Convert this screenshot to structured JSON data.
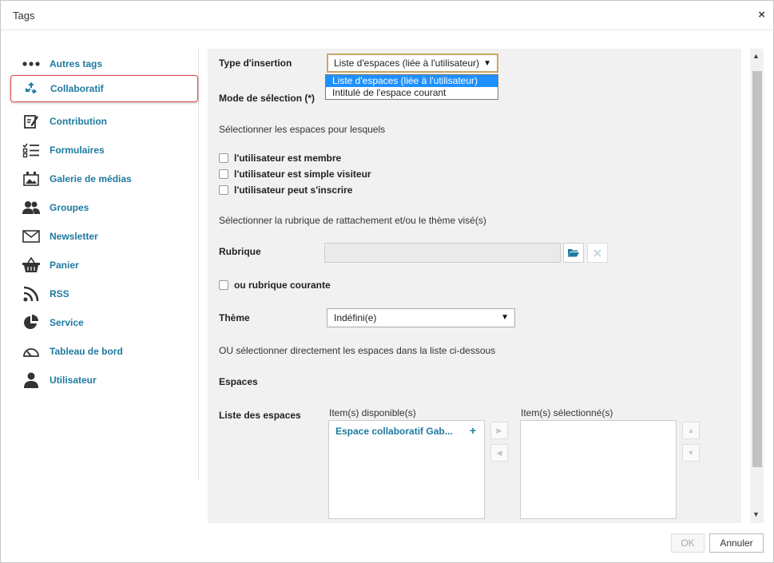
{
  "dialog": {
    "title": "Tags",
    "close_label": "×"
  },
  "sidebar": {
    "items": [
      {
        "label": "Autres tags"
      },
      {
        "label": "Collaboratif"
      },
      {
        "label": "Contribution"
      },
      {
        "label": "Formulaires"
      },
      {
        "label": "Galerie de médias"
      },
      {
        "label": "Groupes"
      },
      {
        "label": "Newsletter"
      },
      {
        "label": "Panier"
      },
      {
        "label": "RSS"
      },
      {
        "label": "Service"
      },
      {
        "label": "Tableau de bord"
      },
      {
        "label": "Utilisateur"
      }
    ]
  },
  "form": {
    "type_insertion_label": "Type d'insertion",
    "type_insertion_value": "Liste d'espaces (liée à l'utilisateur)",
    "type_insertion_options": [
      "Liste d'espaces (liée à l'utilisateur)",
      "Intitulé de l'espace courant"
    ],
    "mode_selection_label": "Mode de sélection (*)",
    "select_spaces_text": "Sélectionner les espaces pour lesquels",
    "checkbox_member": "l'utilisateur est membre",
    "checkbox_visitor": "l'utilisateur est simple visiteur",
    "checkbox_subscribe": "l'utilisateur peut s'inscrire",
    "rubric_help": "Sélectionner la rubrique de rattachement et/ou le thème visé(s)",
    "rubrique_label": "Rubrique",
    "rubrique_value": "",
    "current_rubric_checkbox": "ou rubrique courante",
    "theme_label": "Thème",
    "theme_value": "Indéfini(e)",
    "direct_select_text": "OU sélectionner directement les espaces dans la liste ci-dessous",
    "espaces_label": "Espaces",
    "liste_label": "Liste des espaces",
    "available_header": "Item(s) disponible(s)",
    "selected_header": "Item(s) sélectionné(s)",
    "available_items": [
      "Espace collaboratif Gab..."
    ],
    "add_symbol": "+"
  },
  "footer": {
    "ok_label": "OK",
    "cancel_label": "Annuler"
  },
  "colors": {
    "accent": "#1e7aa0",
    "highlight_border": "#e0474c",
    "selected_option": "#1e90ff"
  }
}
